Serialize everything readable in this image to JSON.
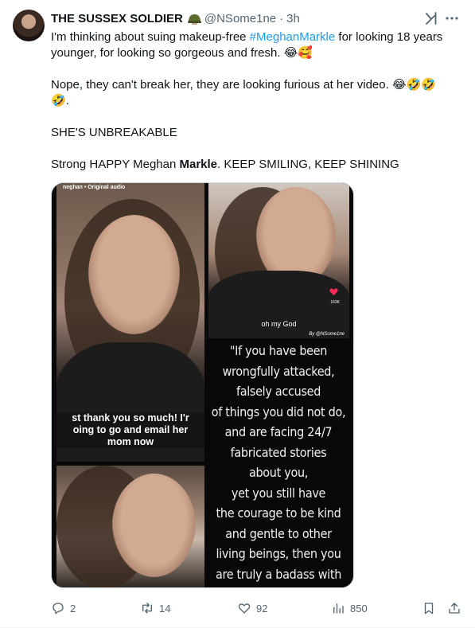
{
  "tweet": {
    "author_name": "THE SUSSEX SOLDIER",
    "author_emoji": "military-helmet-emoji",
    "handle": "@NSome1ne",
    "separator": "·",
    "time": "3h",
    "line1_pre": "I'm thinking about suing makeup-free ",
    "hashtag": "#MeghanMarkle",
    "line1_post": " for looking 18 years younger, for looking so gorgeous and fresh. ",
    "line1_emojis": "😂🥰",
    "line2": "Nope, they can't break her, they are looking furious at her video. ",
    "line2_emojis": "😂🤣🤣",
    "line2_emoji_wrap": "🤣",
    "line2_end": ".",
    "line3": "SHE'S UNBREAKABLE",
    "line4_pre": "Strong HAPPY Meghan ",
    "line4_bold": "Markle",
    "line4_post": ". KEEP SMILING, KEEP SHINING"
  },
  "media": {
    "top_label": "neghan • Original audio",
    "caption_lines": [
      "st thank you so much! I'r",
      "oing to go and email her",
      "mom now"
    ],
    "right_top_text": "oh my God",
    "like_count_small": "163K",
    "credit": "By @NSome1ne",
    "quote_lines": [
      "\"If you have been",
      "wrongfully attacked,",
      "falsely accused",
      "of things you did not do,",
      "and are facing 24/7",
      "fabricated stories",
      "about you,",
      "yet you still have",
      "the courage to be kind",
      "and gentle to other",
      "living beings, then you",
      "are truly a badass with"
    ]
  },
  "actions": {
    "replies": "2",
    "reposts": "14",
    "likes": "92",
    "views": "850"
  },
  "colors": {
    "text": "#0f1419",
    "secondary": "#536471",
    "link": "#1d9bf0",
    "border": "#cfd9de"
  }
}
